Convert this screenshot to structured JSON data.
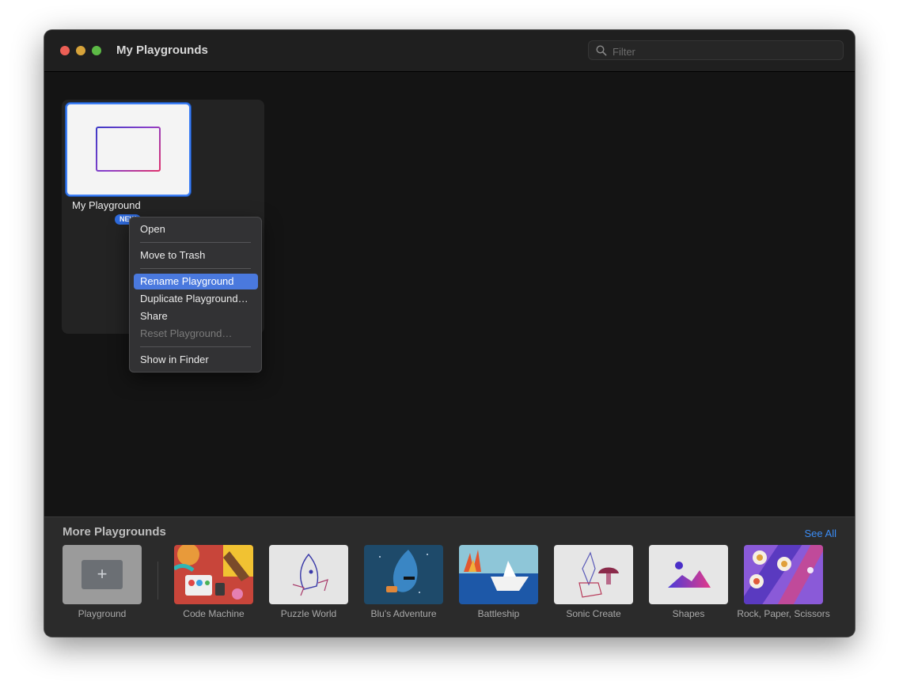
{
  "window": {
    "title": "My Playgrounds",
    "filter_placeholder": "Filter"
  },
  "my_playgrounds": [
    {
      "name": "My Playground",
      "badge": "NEW"
    }
  ],
  "context_menu": {
    "items": [
      {
        "label": "Open",
        "state": "normal"
      },
      {
        "label": "Move to Trash",
        "state": "normal"
      },
      {
        "label": "Rename Playground",
        "state": "highlighted"
      },
      {
        "label": "Duplicate Playground…",
        "state": "normal"
      },
      {
        "label": "Share",
        "state": "normal"
      },
      {
        "label": "Reset Playground…",
        "state": "disabled"
      },
      {
        "label": "Show in Finder",
        "state": "normal"
      }
    ]
  },
  "more_playgrounds": {
    "title": "More Playgrounds",
    "see_all": "See All",
    "items": [
      {
        "label": "Playground"
      },
      {
        "label": "Code Machine"
      },
      {
        "label": "Puzzle World"
      },
      {
        "label": "Blu's Adventure"
      },
      {
        "label": "Battleship"
      },
      {
        "label": "Sonic Create"
      },
      {
        "label": "Shapes"
      },
      {
        "label": "Rock, Paper, Scissors"
      }
    ]
  },
  "colors": {
    "accent": "#3b8cf5",
    "menu_highlight": "#4a79de",
    "window_bg": "#141414"
  }
}
